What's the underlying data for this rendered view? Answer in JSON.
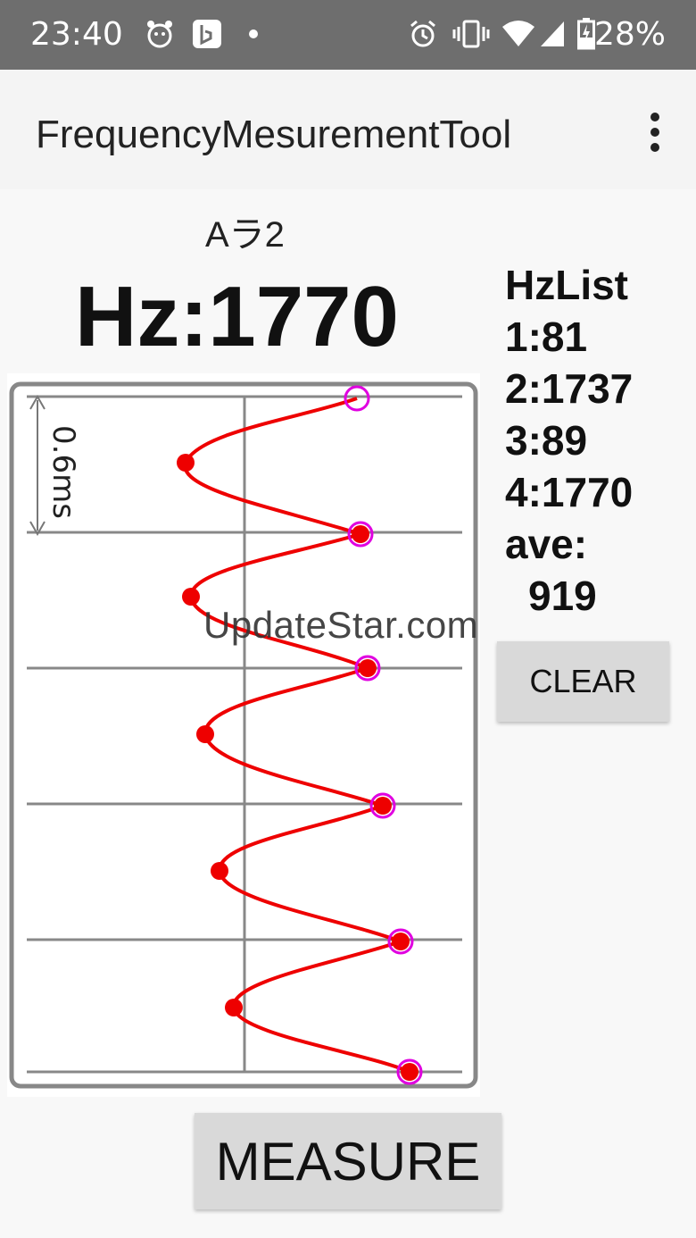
{
  "status_bar": {
    "time": "23:40",
    "battery_percent": "28%",
    "icons": [
      "alarm-clock-app-icon",
      "bing-icon",
      "dot-icon",
      "alarm-icon",
      "vibrate-icon",
      "wifi-icon",
      "signal-icon",
      "battery-charging-icon"
    ]
  },
  "app_bar": {
    "title": "FrequencyMesurementTool",
    "menu_icon": "overflow-menu-icon"
  },
  "reading": {
    "note": "Aラ2",
    "hz": "Hz:1770"
  },
  "hz_list": {
    "title": "HzList",
    "items": [
      "1:81",
      "2:1737",
      "3:89",
      "4:1770"
    ],
    "ave_label": "ave:",
    "ave_value": "919"
  },
  "buttons": {
    "clear": "CLEAR",
    "measure": "MEASURE"
  },
  "waveform": {
    "scale_label": "0.6ms",
    "watermark": "UpdateStar.com",
    "colors": {
      "wave": "#ee0000",
      "marker": "#e000e0",
      "grid": "#888888"
    }
  }
}
